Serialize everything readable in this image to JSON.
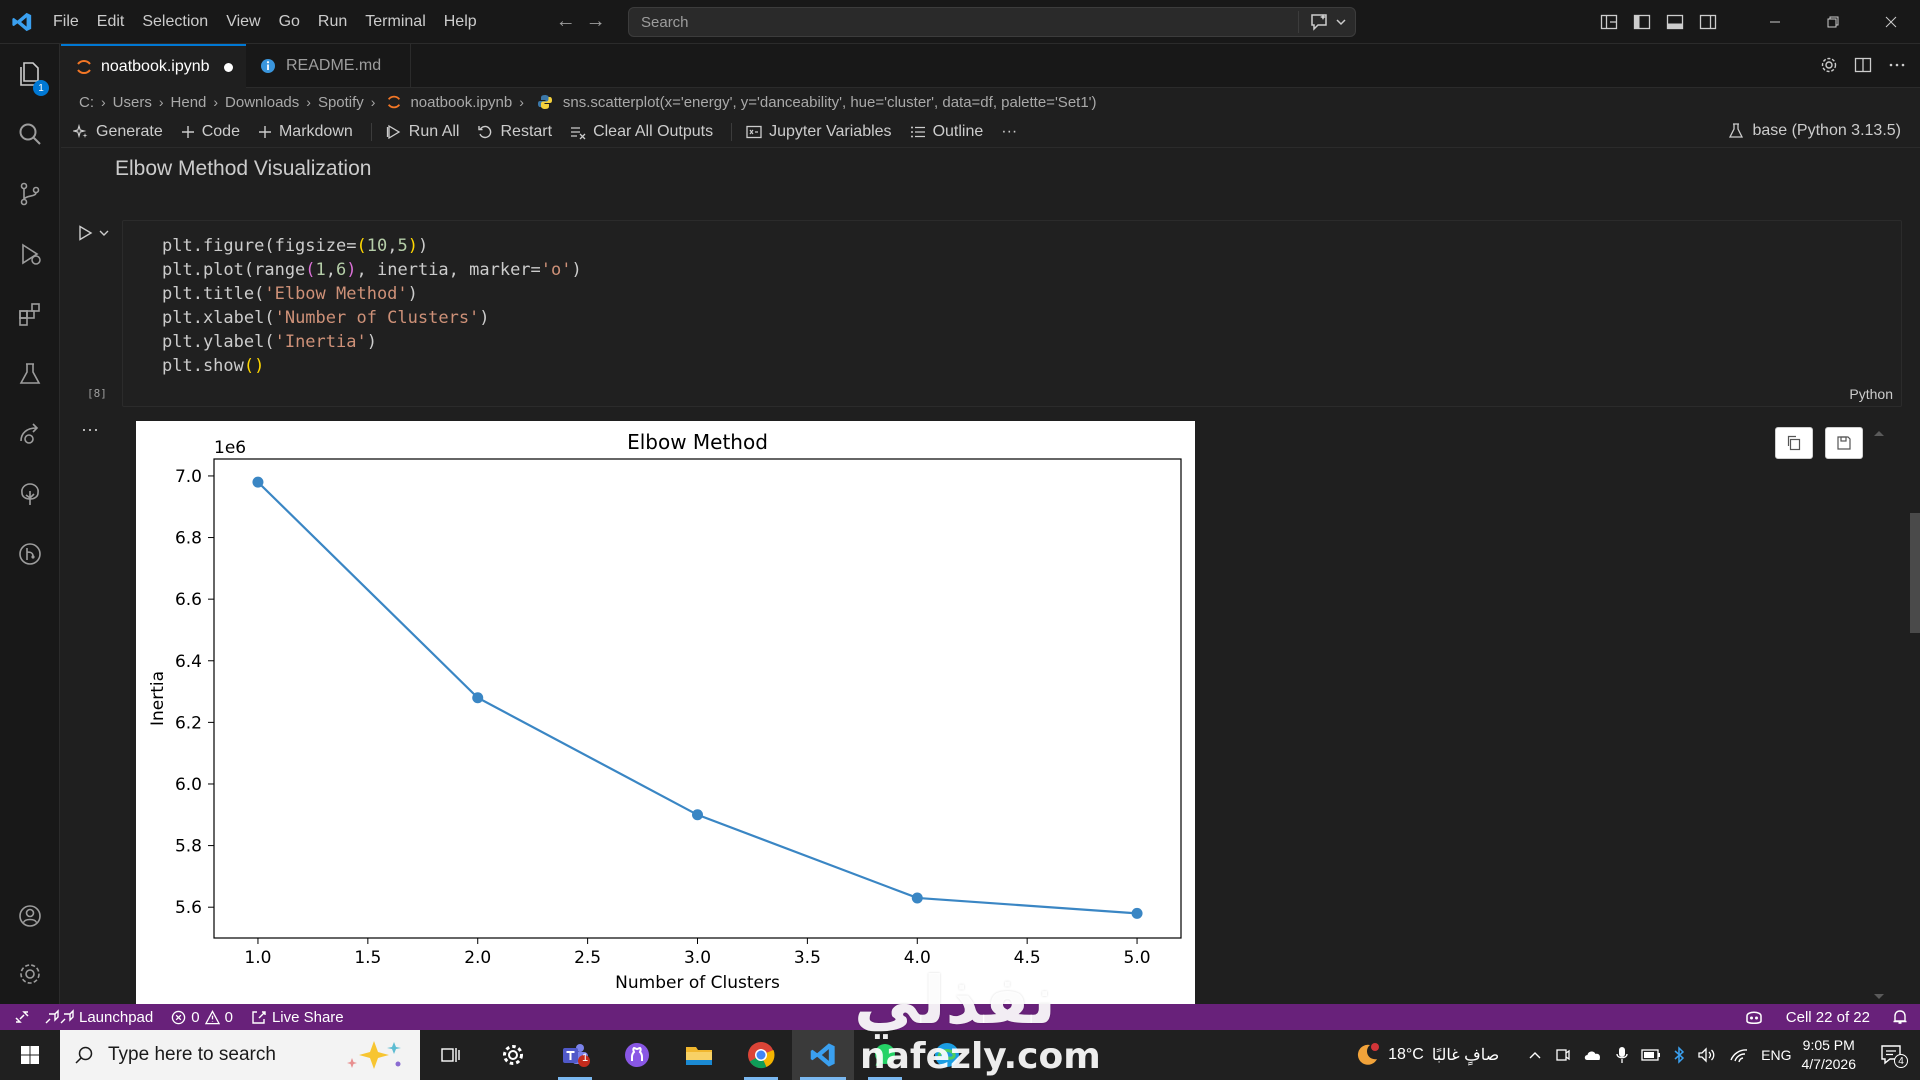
{
  "titlebar": {
    "menu": [
      "File",
      "Edit",
      "Selection",
      "View",
      "Go",
      "Run",
      "Terminal",
      "Help"
    ],
    "search_placeholder": "Search"
  },
  "activity_bar": {
    "items": [
      "explorer-icon",
      "search-icon",
      "source-control-icon",
      "run-debug-icon",
      "extensions-icon",
      "testing-icon",
      "remote-explorer-icon",
      "tree-icon",
      "github-icon",
      "account-icon",
      "manage-gear-icon"
    ],
    "explorer_badge": "1"
  },
  "tabs": [
    {
      "label": "noatbook.ipynb",
      "active": true,
      "modified": true
    },
    {
      "label": "README.md",
      "active": false
    }
  ],
  "breadcrumb": [
    "C:",
    "Users",
    "Hend",
    "Downloads",
    "Spotify",
    "noatbook.ipynb",
    "sns.scatterplot(x='energy', y='danceability', hue='cluster', data=df, palette='Set1')"
  ],
  "toolbar": {
    "generate": "Generate",
    "code": "Code",
    "markdown": "Markdown",
    "run_all": "Run All",
    "restart": "Restart",
    "clear_outputs": "Clear All Outputs",
    "variables": "Jupyter Variables",
    "outline": "Outline",
    "more": "···",
    "kernel": "base (Python 3.13.5)"
  },
  "notebook": {
    "markdown_heading": "Elbow Method Visualization",
    "cell": {
      "execution_count": "[8]",
      "language": "Python",
      "output_more": "···"
    }
  },
  "chart_data": {
    "type": "line",
    "title": "Elbow Method",
    "xlabel": "Number of Clusters",
    "ylabel": "Inertia",
    "y_offset_label": "1e6",
    "x": [
      1,
      2,
      3,
      4,
      5
    ],
    "values": [
      6.98,
      6.28,
      5.9,
      5.63,
      5.58
    ],
    "xlim": [
      0.8,
      5.2
    ],
    "ylim": [
      5.5,
      7.055
    ],
    "xticks": [
      1.0,
      1.5,
      2.0,
      2.5,
      3.0,
      3.5,
      4.0,
      4.5,
      5.0
    ],
    "yticks": [
      5.6,
      5.8,
      6.0,
      6.2,
      6.4,
      6.6,
      6.8,
      7.0
    ],
    "xtick_labels": [
      "1.0",
      "1.5",
      "2.0",
      "2.5",
      "3.0",
      "3.5",
      "4.0",
      "4.5",
      "5.0"
    ],
    "ytick_labels": [
      "5.6",
      "5.8",
      "6.0",
      "6.2",
      "6.4",
      "6.6",
      "6.8",
      "7.0"
    ],
    "line_color": "#3a86c4",
    "marker": "o",
    "grid": false
  },
  "statusbar": {
    "launchpad": "Launchpad",
    "errors": "0",
    "warnings": "0",
    "live_share": "Live Share",
    "cell_position": "Cell 22 of 22",
    "color": "#68217a"
  },
  "taskbar": {
    "search_placeholder": "Type here to search",
    "weather": "18°C",
    "weather_text": "صافٍ غالبًا",
    "language": "ENG",
    "time": "9:05 PM",
    "date": "4/7/2026",
    "notifications": "4",
    "teams_badge": "1"
  },
  "watermark": {
    "arabic": "نفذلي",
    "domain": "nafezly.com"
  }
}
